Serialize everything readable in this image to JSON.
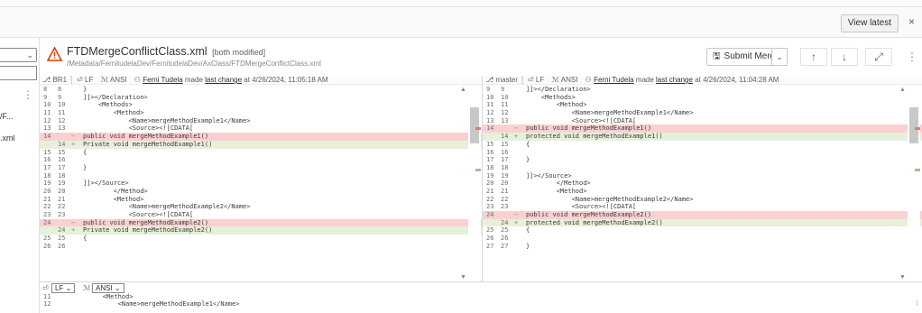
{
  "banner": {
    "view_latest": "View latest",
    "close": "×"
  },
  "left_strip": {
    "text1": "/F...",
    "text2": ".xml"
  },
  "file": {
    "name": "FTDMergeConflictClass.xml",
    "status": "[both modified]",
    "path": "/Metadata/FernitudelaDev/FernitudelaDev/AxClass/FTDMergeConflictClass.xml",
    "submit_merge": "Submit Merge"
  },
  "left_pane": {
    "branch": "BR1",
    "eol": "LF",
    "encoding": "ANSI",
    "author": "Ferni Tudela",
    "made": "made",
    "last_change": "last change",
    "time": "at 4/26/2024, 11:05:18 AM",
    "lines": [
      {
        "a": "8",
        "b": "8",
        "m": "",
        "t": "}",
        "k": "n"
      },
      {
        "a": "9",
        "b": "9",
        "m": "",
        "t": "]]></Declaration>",
        "k": "n"
      },
      {
        "a": "10",
        "b": "10",
        "m": "",
        "t": "    <Methods>",
        "k": "n"
      },
      {
        "a": "11",
        "b": "11",
        "m": "",
        "t": "        <Method>",
        "k": "n"
      },
      {
        "a": "12",
        "b": "12",
        "m": "",
        "t": "            <Name>mergeMethodExample1</Name>",
        "k": "n"
      },
      {
        "a": "13",
        "b": "13",
        "m": "",
        "t": "            <Source><![CDATA[",
        "k": "n"
      },
      {
        "a": "14",
        "b": "",
        "m": "−",
        "t": "public void mergeMethodExample1()",
        "k": "d"
      },
      {
        "a": "",
        "b": "14",
        "m": "+",
        "t": "Private void mergeMethodExample1()",
        "k": "a"
      },
      {
        "a": "15",
        "b": "15",
        "m": "",
        "t": "{",
        "k": "n"
      },
      {
        "a": "16",
        "b": "16",
        "m": "",
        "t": "",
        "k": "n"
      },
      {
        "a": "17",
        "b": "17",
        "m": "",
        "t": "}",
        "k": "n"
      },
      {
        "a": "18",
        "b": "18",
        "m": "",
        "t": "",
        "k": "n"
      },
      {
        "a": "19",
        "b": "19",
        "m": "",
        "t": "]]></Source>",
        "k": "n"
      },
      {
        "a": "20",
        "b": "20",
        "m": "",
        "t": "        </Method>",
        "k": "n"
      },
      {
        "a": "21",
        "b": "21",
        "m": "",
        "t": "        <Method>",
        "k": "n"
      },
      {
        "a": "22",
        "b": "22",
        "m": "",
        "t": "            <Name>mergeMethodExample2</Name>",
        "k": "n"
      },
      {
        "a": "23",
        "b": "23",
        "m": "",
        "t": "            <Source><![CDATA[",
        "k": "n"
      },
      {
        "a": "24",
        "b": "",
        "m": "−",
        "t": "public void mergeMethodExample2()",
        "k": "d"
      },
      {
        "a": "",
        "b": "24",
        "m": "+",
        "t": "Private void mergeMethodExample2()",
        "k": "a"
      },
      {
        "a": "25",
        "b": "25",
        "m": "",
        "t": "{",
        "k": "n"
      },
      {
        "a": "26",
        "b": "26",
        "m": "",
        "t": "",
        "k": "n"
      }
    ]
  },
  "right_pane": {
    "branch": "master",
    "eol": "LF",
    "encoding": "ANSI",
    "author": "Ferni Tudela",
    "made": "made",
    "last_change": "last change",
    "time": "at 4/26/2024, 11:04:28 AM",
    "lines": [
      {
        "a": "9",
        "b": "9",
        "m": "",
        "t": "]]></Declaration>",
        "k": "n"
      },
      {
        "a": "10",
        "b": "10",
        "m": "",
        "t": "    <Methods>",
        "k": "n"
      },
      {
        "a": "11",
        "b": "11",
        "m": "",
        "t": "        <Method>",
        "k": "n"
      },
      {
        "a": "12",
        "b": "12",
        "m": "",
        "t": "            <Name>mergeMethodExample1</Name>",
        "k": "n"
      },
      {
        "a": "13",
        "b": "13",
        "m": "",
        "t": "            <Source><![CDATA[",
        "k": "n"
      },
      {
        "a": "14",
        "b": "",
        "m": "−",
        "t": "public void mergeMethodExample1()",
        "k": "d"
      },
      {
        "a": "",
        "b": "14",
        "m": "+",
        "t": "protected void mergeMethodExample1()",
        "k": "a"
      },
      {
        "a": "15",
        "b": "15",
        "m": "",
        "t": "{",
        "k": "n"
      },
      {
        "a": "16",
        "b": "16",
        "m": "",
        "t": "",
        "k": "n"
      },
      {
        "a": "17",
        "b": "17",
        "m": "",
        "t": "}",
        "k": "n"
      },
      {
        "a": "18",
        "b": "18",
        "m": "",
        "t": "",
        "k": "n"
      },
      {
        "a": "19",
        "b": "19",
        "m": "",
        "t": "]]></Source>",
        "k": "n"
      },
      {
        "a": "20",
        "b": "20",
        "m": "",
        "t": "        </Method>",
        "k": "n"
      },
      {
        "a": "21",
        "b": "21",
        "m": "",
        "t": "        <Method>",
        "k": "n"
      },
      {
        "a": "22",
        "b": "22",
        "m": "",
        "t": "            <Name>mergeMethodExample2</Name>",
        "k": "n"
      },
      {
        "a": "23",
        "b": "23",
        "m": "",
        "t": "            <Source><![CDATA[",
        "k": "n"
      },
      {
        "a": "24",
        "b": "",
        "m": "−",
        "t": "public void mergeMethodExample2()",
        "k": "d"
      },
      {
        "a": "",
        "b": "24",
        "m": "+",
        "t": "protected void mergeMethodExample2()",
        "k": "a"
      },
      {
        "a": "25",
        "b": "25",
        "m": "",
        "t": "{",
        "k": "n"
      },
      {
        "a": "26",
        "b": "26",
        "m": "",
        "t": "",
        "k": "n"
      },
      {
        "a": "27",
        "b": "27",
        "m": "",
        "t": "}",
        "k": "n"
      }
    ]
  },
  "bottom_bar": {
    "eol": "LF",
    "encoding": "ANSI"
  },
  "result": {
    "lines": [
      {
        "a": "11",
        "t": "        <Method>"
      },
      {
        "a": "12",
        "t": "            <Name>mergeMethodExample1</Name>"
      }
    ]
  },
  "colors": {
    "deleted_bg": "#fbd0d0",
    "added_bg": "#e6f0da",
    "warning": "#d83b01"
  }
}
